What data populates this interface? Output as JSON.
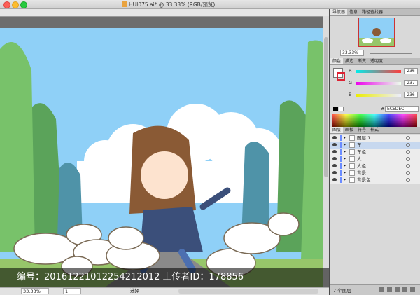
{
  "window": {
    "title": "HUI075.ai* @ 33.33% (RGB/预览)"
  },
  "statusbar": {
    "zoom": "33.33%",
    "page": "1",
    "tool": "选择"
  },
  "watermark": {
    "text": "编号：20161221012254212012 上传者ID：178856"
  },
  "navigator": {
    "tabs": [
      "导航器",
      "信息",
      "路径查找器"
    ],
    "zoom": "33.33%"
  },
  "color": {
    "tabs": [
      "颜色",
      "描边",
      "渐变",
      "透明度"
    ],
    "channels": [
      {
        "label": "R",
        "value": "236",
        "color": "#ff3b3b"
      },
      {
        "label": "G",
        "value": "237",
        "color": "#ae3bd6"
      },
      {
        "label": "B",
        "value": "236",
        "color": "#ddd52c"
      }
    ],
    "hex_label": "#",
    "hex": "ECEDEC"
  },
  "layers": {
    "tabs": [
      "图层",
      "画板",
      "符号",
      "样式"
    ],
    "items": [
      {
        "name": "图层 1",
        "color": "#6b8cff",
        "selected": false,
        "arrow": "▾"
      },
      {
        "name": "羊",
        "color": "#6b8cff",
        "selected": true,
        "arrow": "▸"
      },
      {
        "name": "羊色",
        "color": "#6b8cff",
        "selected": false,
        "arrow": "▸"
      },
      {
        "name": "人",
        "color": "#6b8cff",
        "selected": false,
        "arrow": "▸"
      },
      {
        "name": "人色",
        "color": "#6b8cff",
        "selected": false,
        "arrow": "▸"
      },
      {
        "name": "背景",
        "color": "#6b8cff",
        "selected": false,
        "arrow": "▸"
      },
      {
        "name": "背景色",
        "color": "#6b8cff",
        "selected": false,
        "arrow": "▸"
      }
    ],
    "count": "7 个图层"
  },
  "accent": {
    "sky": "#8fd0f7",
    "road": "#8a8a8a"
  }
}
